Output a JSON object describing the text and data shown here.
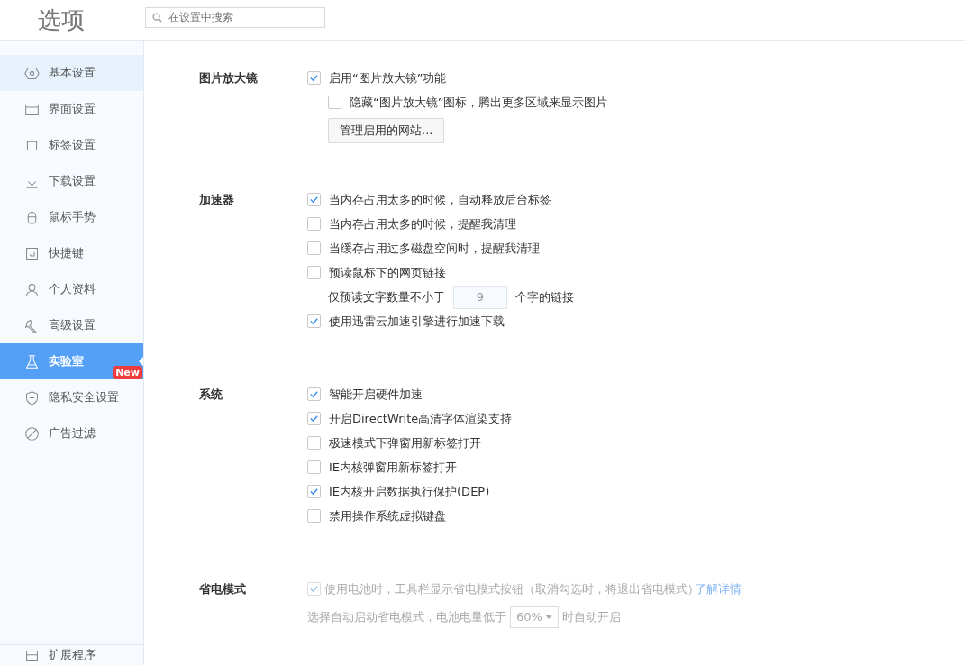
{
  "header": {
    "title": "选项",
    "search": {
      "placeholder": "在设置中搜索"
    }
  },
  "sidebar": {
    "items": [
      {
        "label": "基本设置",
        "selected": false,
        "hovered": true
      },
      {
        "label": "界面设置",
        "selected": false,
        "hovered": false
      },
      {
        "label": "标签设置",
        "selected": false,
        "hovered": false
      },
      {
        "label": "下载设置",
        "selected": false,
        "hovered": false
      },
      {
        "label": "鼠标手势",
        "selected": false,
        "hovered": false
      },
      {
        "label": "快捷键",
        "selected": false,
        "hovered": false
      },
      {
        "label": "个人资料",
        "selected": false,
        "hovered": false
      },
      {
        "label": "高级设置",
        "selected": false,
        "hovered": false
      },
      {
        "label": "实验室",
        "selected": true,
        "hovered": false,
        "badge": "New"
      },
      {
        "label": "隐私安全设置",
        "selected": false,
        "hovered": false
      },
      {
        "label": "广告过滤",
        "selected": false,
        "hovered": false
      }
    ],
    "footer_item": {
      "label": "扩展程序"
    }
  },
  "sections": [
    {
      "title": "图片放大镜",
      "disabled": false,
      "items": [
        {
          "kind": "checkbox",
          "label": "启用“图片放大镜”功能",
          "checked": true,
          "children": [
            {
              "kind": "checkbox",
              "label": "隐藏“图片放大镜”图标，腾出更多区域来显示图片",
              "checked": false
            },
            {
              "kind": "button",
              "label": "管理启用的网站..."
            }
          ]
        }
      ]
    },
    {
      "title": "加速器",
      "disabled": false,
      "items": [
        {
          "kind": "checkbox",
          "label": "当内存占用太多的时候，自动释放后台标签",
          "checked": true
        },
        {
          "kind": "checkbox",
          "label": "当内存占用太多的时候，提醒我清理",
          "checked": false
        },
        {
          "kind": "checkbox",
          "label": "当缓存占用过多磁盘空间时，提醒我清理",
          "checked": false
        },
        {
          "kind": "checkbox",
          "label": "预读鼠标下的网页链接",
          "checked": false,
          "children": [
            {
              "kind": "number-input",
              "before": "仅预读文字数量不小于",
              "value": "9",
              "after": "个字的链接"
            }
          ]
        },
        {
          "kind": "checkbox",
          "label": "使用迅雷云加速引擎进行加速下载",
          "checked": true
        }
      ]
    },
    {
      "title": "系统",
      "disabled": false,
      "items": [
        {
          "kind": "checkbox",
          "label": "智能开启硬件加速",
          "checked": true
        },
        {
          "kind": "checkbox",
          "label": "开启DirectWrite高清字体渲染支持",
          "checked": true
        },
        {
          "kind": "checkbox",
          "label": "极速模式下弹窗用新标签打开",
          "checked": false
        },
        {
          "kind": "checkbox",
          "label": "IE内核弹窗用新标签打开",
          "checked": false
        },
        {
          "kind": "checkbox",
          "label": "IE内核开启数据执行保护(DEP)",
          "checked": true
        },
        {
          "kind": "checkbox",
          "label": "禁用操作系统虚拟键盘",
          "checked": false
        }
      ]
    },
    {
      "title": "省电模式",
      "disabled": true,
      "items": [
        {
          "kind": "checkbox",
          "label": "使用电池时，工具栏显示省电模式按钮（取消勾选时，将退出省电模式）",
          "checked": true,
          "link": "了解详情"
        },
        {
          "kind": "select",
          "before": "选择自动启动省电模式，电池电量低于",
          "value": "60%",
          "after": "时自动开启"
        }
      ]
    }
  ]
}
